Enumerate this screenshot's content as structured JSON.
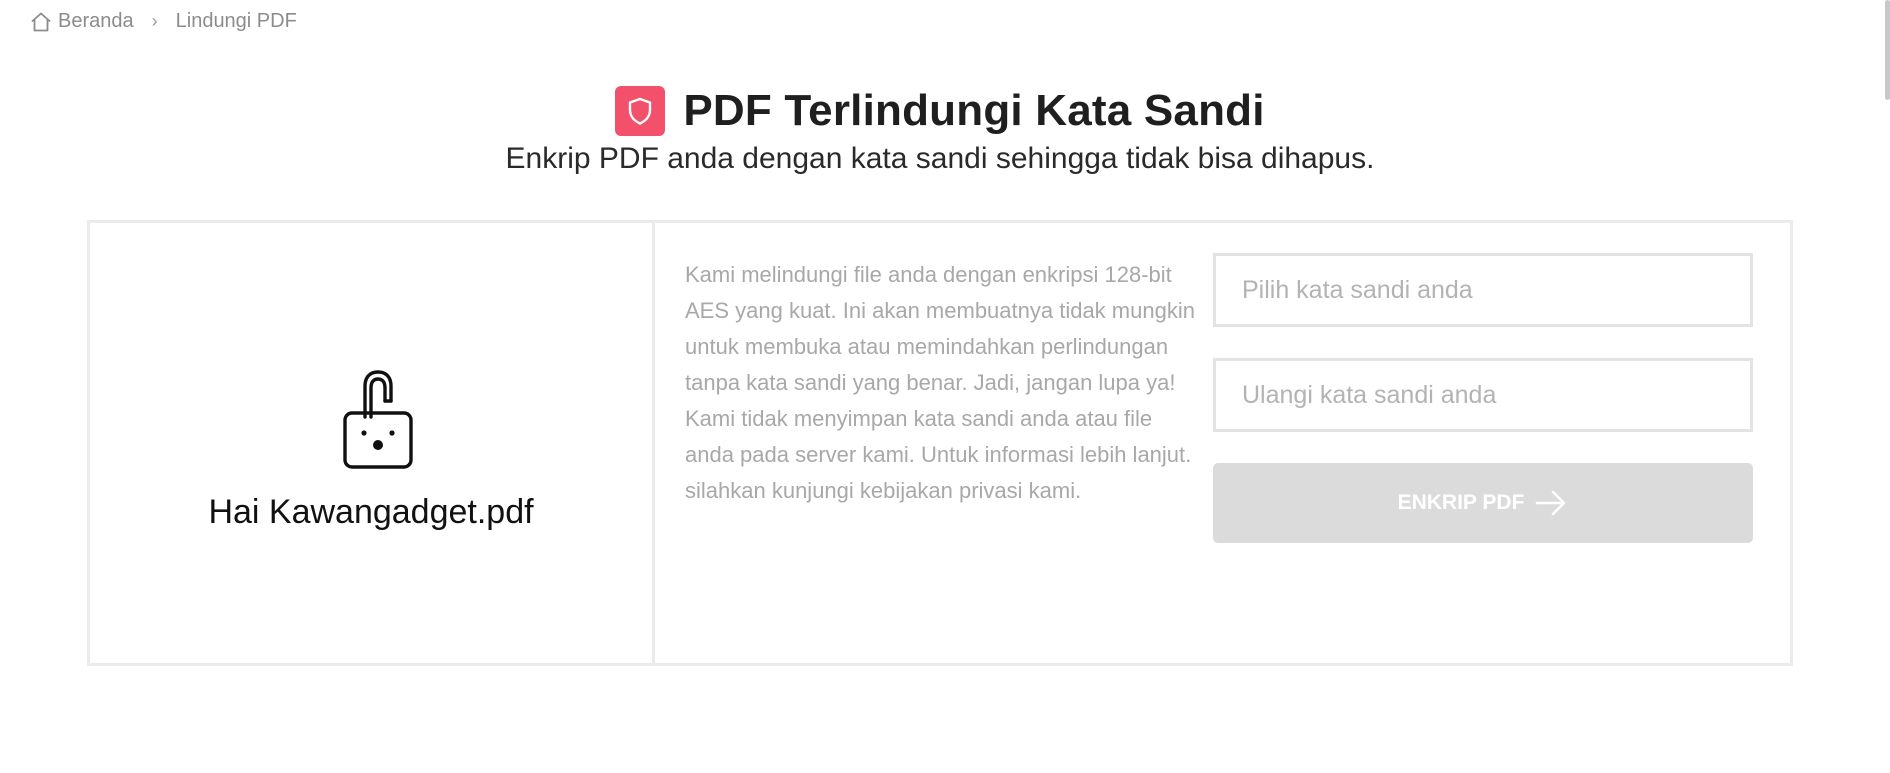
{
  "breadcrumb": {
    "home_icon": "home-icon",
    "home_label": "Beranda",
    "separator": "›",
    "current": "Lindungi PDF"
  },
  "header": {
    "icon": "shield-icon",
    "icon_color": "#f2506b",
    "title": "PDF Terlindungi Kata Sandi",
    "subtitle": "Enkrip PDF anda dengan kata sandi sehingga tidak bisa dihapus."
  },
  "file": {
    "icon": "unlocked-padlock-icon",
    "name": "Hai Kawangadget.pdf"
  },
  "info": {
    "paragraph_1": "Kami melindungi file anda dengan enkripsi 128-bit AES yang kuat. Ini akan membuatnya tidak mungkin untuk membuka atau memindahkan perlindungan tanpa kata sandi yang benar. Jadi, jangan lupa ya!",
    "paragraph_2": "Kami tidak menyimpan kata sandi anda atau file anda pada server kami. Untuk informasi lebih lanjut. silahkan kunjungi kebijakan privasi kami."
  },
  "form": {
    "password_value": "",
    "password_placeholder": "Pilih kata sandi anda",
    "repeat_value": "",
    "repeat_placeholder": "Ulangi kata sandi anda",
    "submit_label": "ENKRIP PDF",
    "submit_icon": "arrow-right-icon",
    "submit_color": "#dbdbdb"
  }
}
